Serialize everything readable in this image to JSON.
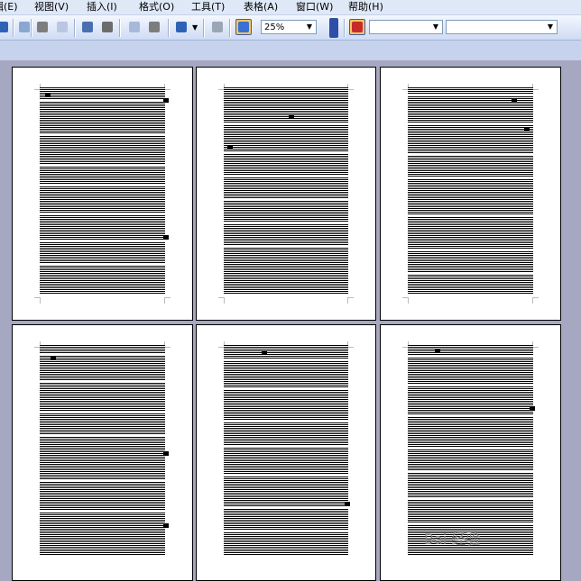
{
  "menubar": {
    "items": [
      {
        "label": "编辑(E)"
      },
      {
        "label": "视图(V)"
      },
      {
        "label": "插入(I)"
      },
      {
        "label": "格式(O)"
      },
      {
        "label": "工具(T)"
      },
      {
        "label": "表格(A)"
      },
      {
        "label": "窗口(W)"
      },
      {
        "label": "帮助(H)"
      }
    ]
  },
  "toolbar": {
    "zoom_value": "25%",
    "style_value": "",
    "font_value": ""
  },
  "watermark": {
    "text": "Bai 经验"
  }
}
